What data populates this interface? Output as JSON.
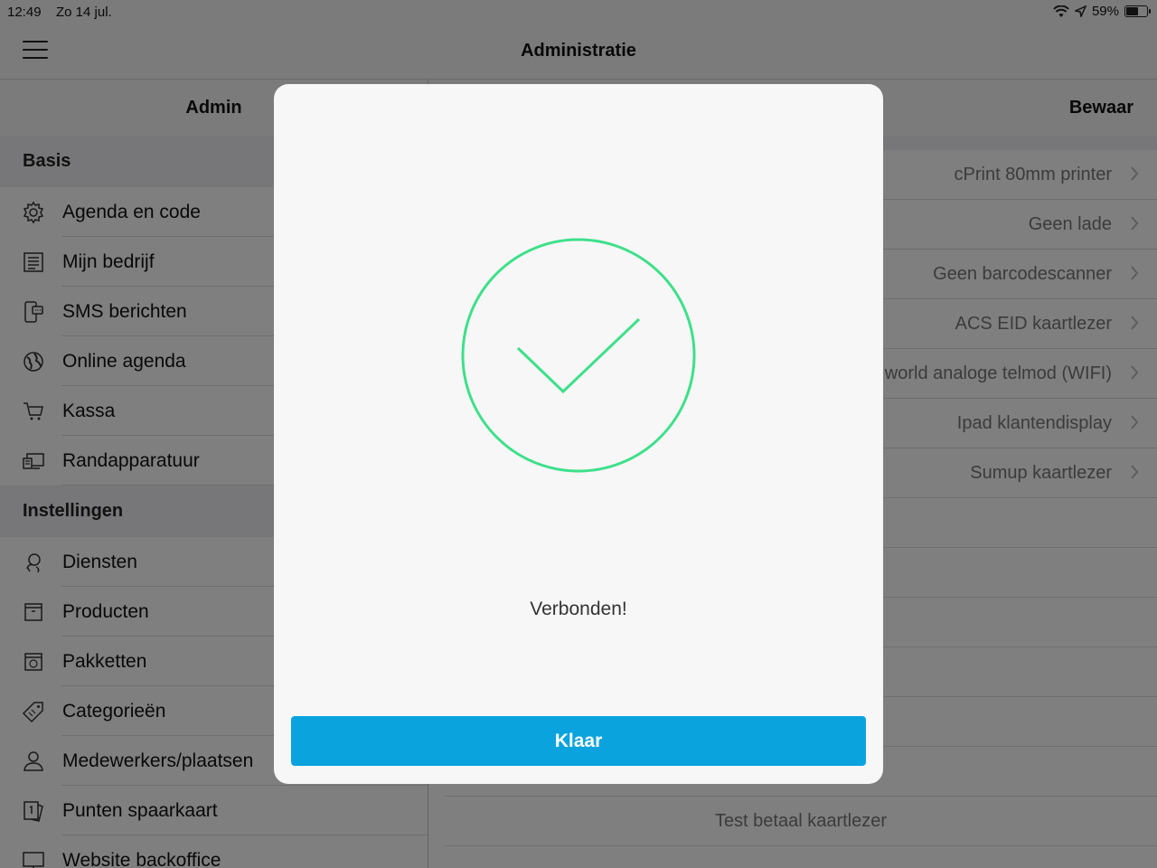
{
  "status": {
    "time": "12:49",
    "date": "Zo 14 jul.",
    "battery_pct": "59%",
    "battery_level": 0.59
  },
  "nav": {
    "title": "Administratie"
  },
  "left": {
    "header": "Admin",
    "sections": [
      {
        "title": "Basis",
        "items": [
          {
            "label": "Agenda en code",
            "icon": "gear-icon"
          },
          {
            "label": "Mijn bedrijf",
            "icon": "document-list-icon"
          },
          {
            "label": "SMS berichten",
            "icon": "phone-message-icon"
          },
          {
            "label": "Online agenda",
            "icon": "globe-icon"
          },
          {
            "label": "Kassa",
            "icon": "shopping-cart-icon"
          },
          {
            "label": "Randapparatuur",
            "icon": "devices-icon"
          }
        ]
      },
      {
        "title": "Instellingen",
        "items": [
          {
            "label": "Diensten",
            "icon": "person-service-icon"
          },
          {
            "label": "Producten",
            "icon": "box-icon"
          },
          {
            "label": "Pakketten",
            "icon": "package-icon"
          },
          {
            "label": "Categorieën",
            "icon": "tags-icon"
          },
          {
            "label": "Medewerkers/plaatsen",
            "icon": "person-icon"
          },
          {
            "label": "Punten spaarkaart",
            "icon": "loyalty-card-icon"
          },
          {
            "label": "Website backoffice",
            "icon": "monitor-icon"
          }
        ]
      }
    ]
  },
  "right": {
    "save_label": "Bewaar",
    "rows": [
      "cPrint 80mm printer",
      "Geen lade",
      "Geen barcodescanner",
      "ACS EID kaartlezer",
      "world analoge telmod (WIFI)",
      "Ipad klantendisplay",
      "Sumup kaartlezer"
    ],
    "test_label": "Test betaal kaartlezer"
  },
  "modal": {
    "message": "Verbonden!",
    "button_label": "Klaar",
    "accent": "#3ee08a",
    "button_color": "#0aa3de"
  }
}
